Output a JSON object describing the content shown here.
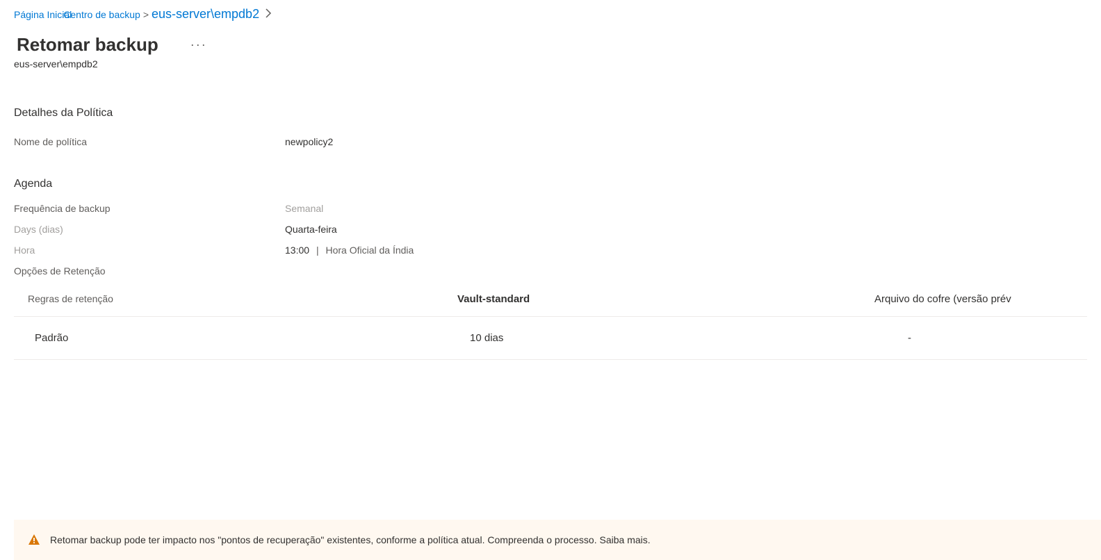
{
  "breadcrumb": {
    "link1": "Página Inicial",
    "link2": "Centro de backup",
    "current": "eus-server\\empdb2"
  },
  "page": {
    "title": "Retomar backup",
    "subtitle": "eus-server\\empdb2"
  },
  "policy": {
    "section_title": "Detalhes da Política",
    "name_label": "Nome de política",
    "name_value": "newpolicy2"
  },
  "schedule": {
    "section_title": "Agenda",
    "freq_label": "Frequência de backup",
    "freq_value": "Semanal",
    "days_label": "Days (dias)",
    "days_value": "Quarta-feira",
    "time_label": "Hora",
    "time_value": "13:00",
    "tz_value": "Hora Oficial da Índia",
    "retention_options_label": "Opções de Retenção"
  },
  "retention_table": {
    "col1_header": "Regras de retenção",
    "col2_header": "Vault-standard",
    "col3_header": "Arquivo do cofre (versão prév",
    "rows": [
      {
        "rule": "Padrão",
        "vault": "10 dias",
        "archive": "-"
      }
    ]
  },
  "warning": {
    "text": "Retomar backup pode ter impacto nos \"pontos de recuperação\" existentes, conforme a política atual. Compreenda o processo. Saiba mais."
  }
}
